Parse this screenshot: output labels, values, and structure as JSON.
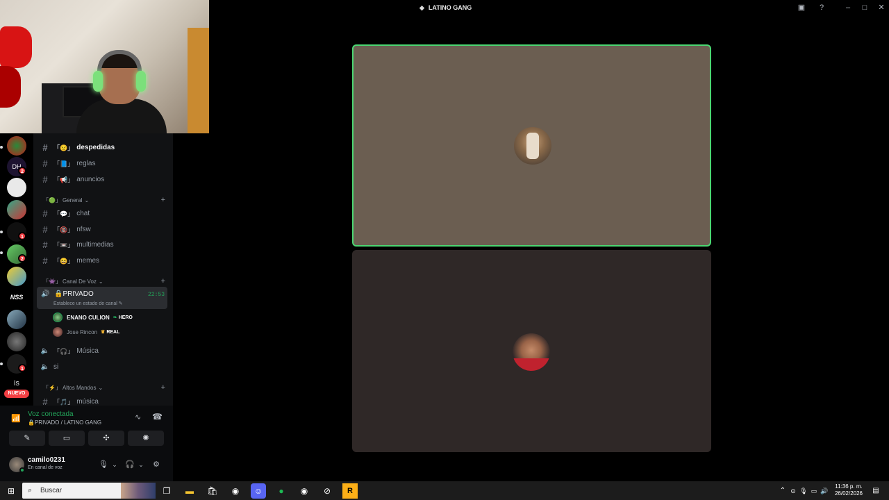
{
  "window": {
    "title": "LATINO GANG"
  },
  "webcam": {},
  "server_rail": {
    "badges": [
      "2",
      "1",
      "2",
      "1"
    ],
    "text_item": "is",
    "new_label": "NUEVO"
  },
  "channels": {
    "text_channels": [
      {
        "emoji": "「😟」",
        "name": "despedidas",
        "bold": true
      },
      {
        "emoji": "「📘」",
        "name": "reglas"
      },
      {
        "emoji": "「📢」",
        "name": "anuncios"
      }
    ],
    "category_general": {
      "emoji": "「🟢」",
      "label": "General"
    },
    "general_channels": [
      {
        "emoji": "「💬」",
        "name": "chat"
      },
      {
        "emoji": "「🔞」",
        "name": "nfsw"
      },
      {
        "emoji": "「📼」",
        "name": "multimedias"
      },
      {
        "emoji": "「😆」",
        "name": "memes"
      }
    ],
    "category_voice": {
      "emoji": "「👾」",
      "label": "Canal De Voz"
    },
    "active_voice": {
      "name": "🔒PRIVADO",
      "status_hint": "Establece un estado de canal ✎",
      "timer": "22:53",
      "members": [
        {
          "name": "ENANO CULION",
          "tag": "HERO"
        },
        {
          "name": "Jose Rincon",
          "tag": "REAL"
        }
      ]
    },
    "voice_channels": [
      {
        "emoji": "「🎧」",
        "name": "Música"
      },
      {
        "emoji": "",
        "name": "si"
      }
    ],
    "category_altos": {
      "emoji": "「⚡」",
      "label": "Altos Mandos"
    },
    "altos_channels": [
      {
        "emoji": "「🎵」",
        "name": "música"
      }
    ]
  },
  "voice_panel": {
    "status": "Voz conectada",
    "channel": "🔒PRIVADO / LATINO GANG"
  },
  "user_panel": {
    "username": "camilo0231",
    "status": "En canal de voz"
  },
  "taskbar": {
    "search_placeholder": "Buscar",
    "time": "11:36 p. m.",
    "date": "26/02/2026"
  },
  "colors": {
    "speaking_border": "#4bd672",
    "voice_connected": "#23a55a",
    "badge": "#f23f43"
  }
}
